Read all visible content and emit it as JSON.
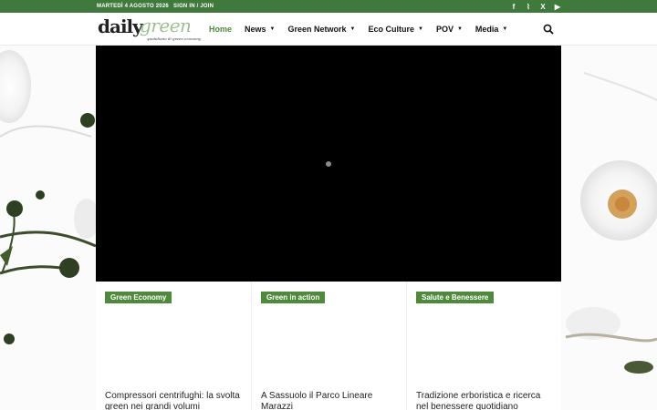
{
  "topbar": {
    "date": "MARTEDÌ 4 AGOSTO 2026",
    "signin": "SIGN IN / JOIN",
    "social": [
      {
        "icon": "facebook-icon",
        "glyph": "f"
      },
      {
        "icon": "rss-icon",
        "glyph": "⌇"
      },
      {
        "icon": "x-icon",
        "glyph": "X"
      },
      {
        "icon": "youtube-icon",
        "glyph": "▶"
      }
    ]
  },
  "logo": {
    "word1": "daily",
    "word2": "green",
    "tagline": "quotidiano di green economy"
  },
  "nav": {
    "items": [
      {
        "label": "Home",
        "active": true,
        "dropdown": false
      },
      {
        "label": "News",
        "active": false,
        "dropdown": true
      },
      {
        "label": "Green Network",
        "active": false,
        "dropdown": true
      },
      {
        "label": "Eco Culture",
        "active": false,
        "dropdown": true
      },
      {
        "label": "POV",
        "active": false,
        "dropdown": true
      },
      {
        "label": "Media",
        "active": false,
        "dropdown": true
      }
    ]
  },
  "cards": [
    {
      "badge": "Green Economy",
      "title": "Compressori centrifughi: la svolta green nei grandi volumi"
    },
    {
      "badge": "Green in action",
      "title": "A Sassuolo il Parco Lineare Marazzi"
    },
    {
      "badge": "Salute e Benessere",
      "title": "Tradizione erboristica e ricerca nel benessere quotidiano"
    }
  ],
  "colors": {
    "brand_green": "#3f7a3c",
    "badge_green": "#4d8a3a",
    "logo_light_green": "#9fbf8f"
  }
}
